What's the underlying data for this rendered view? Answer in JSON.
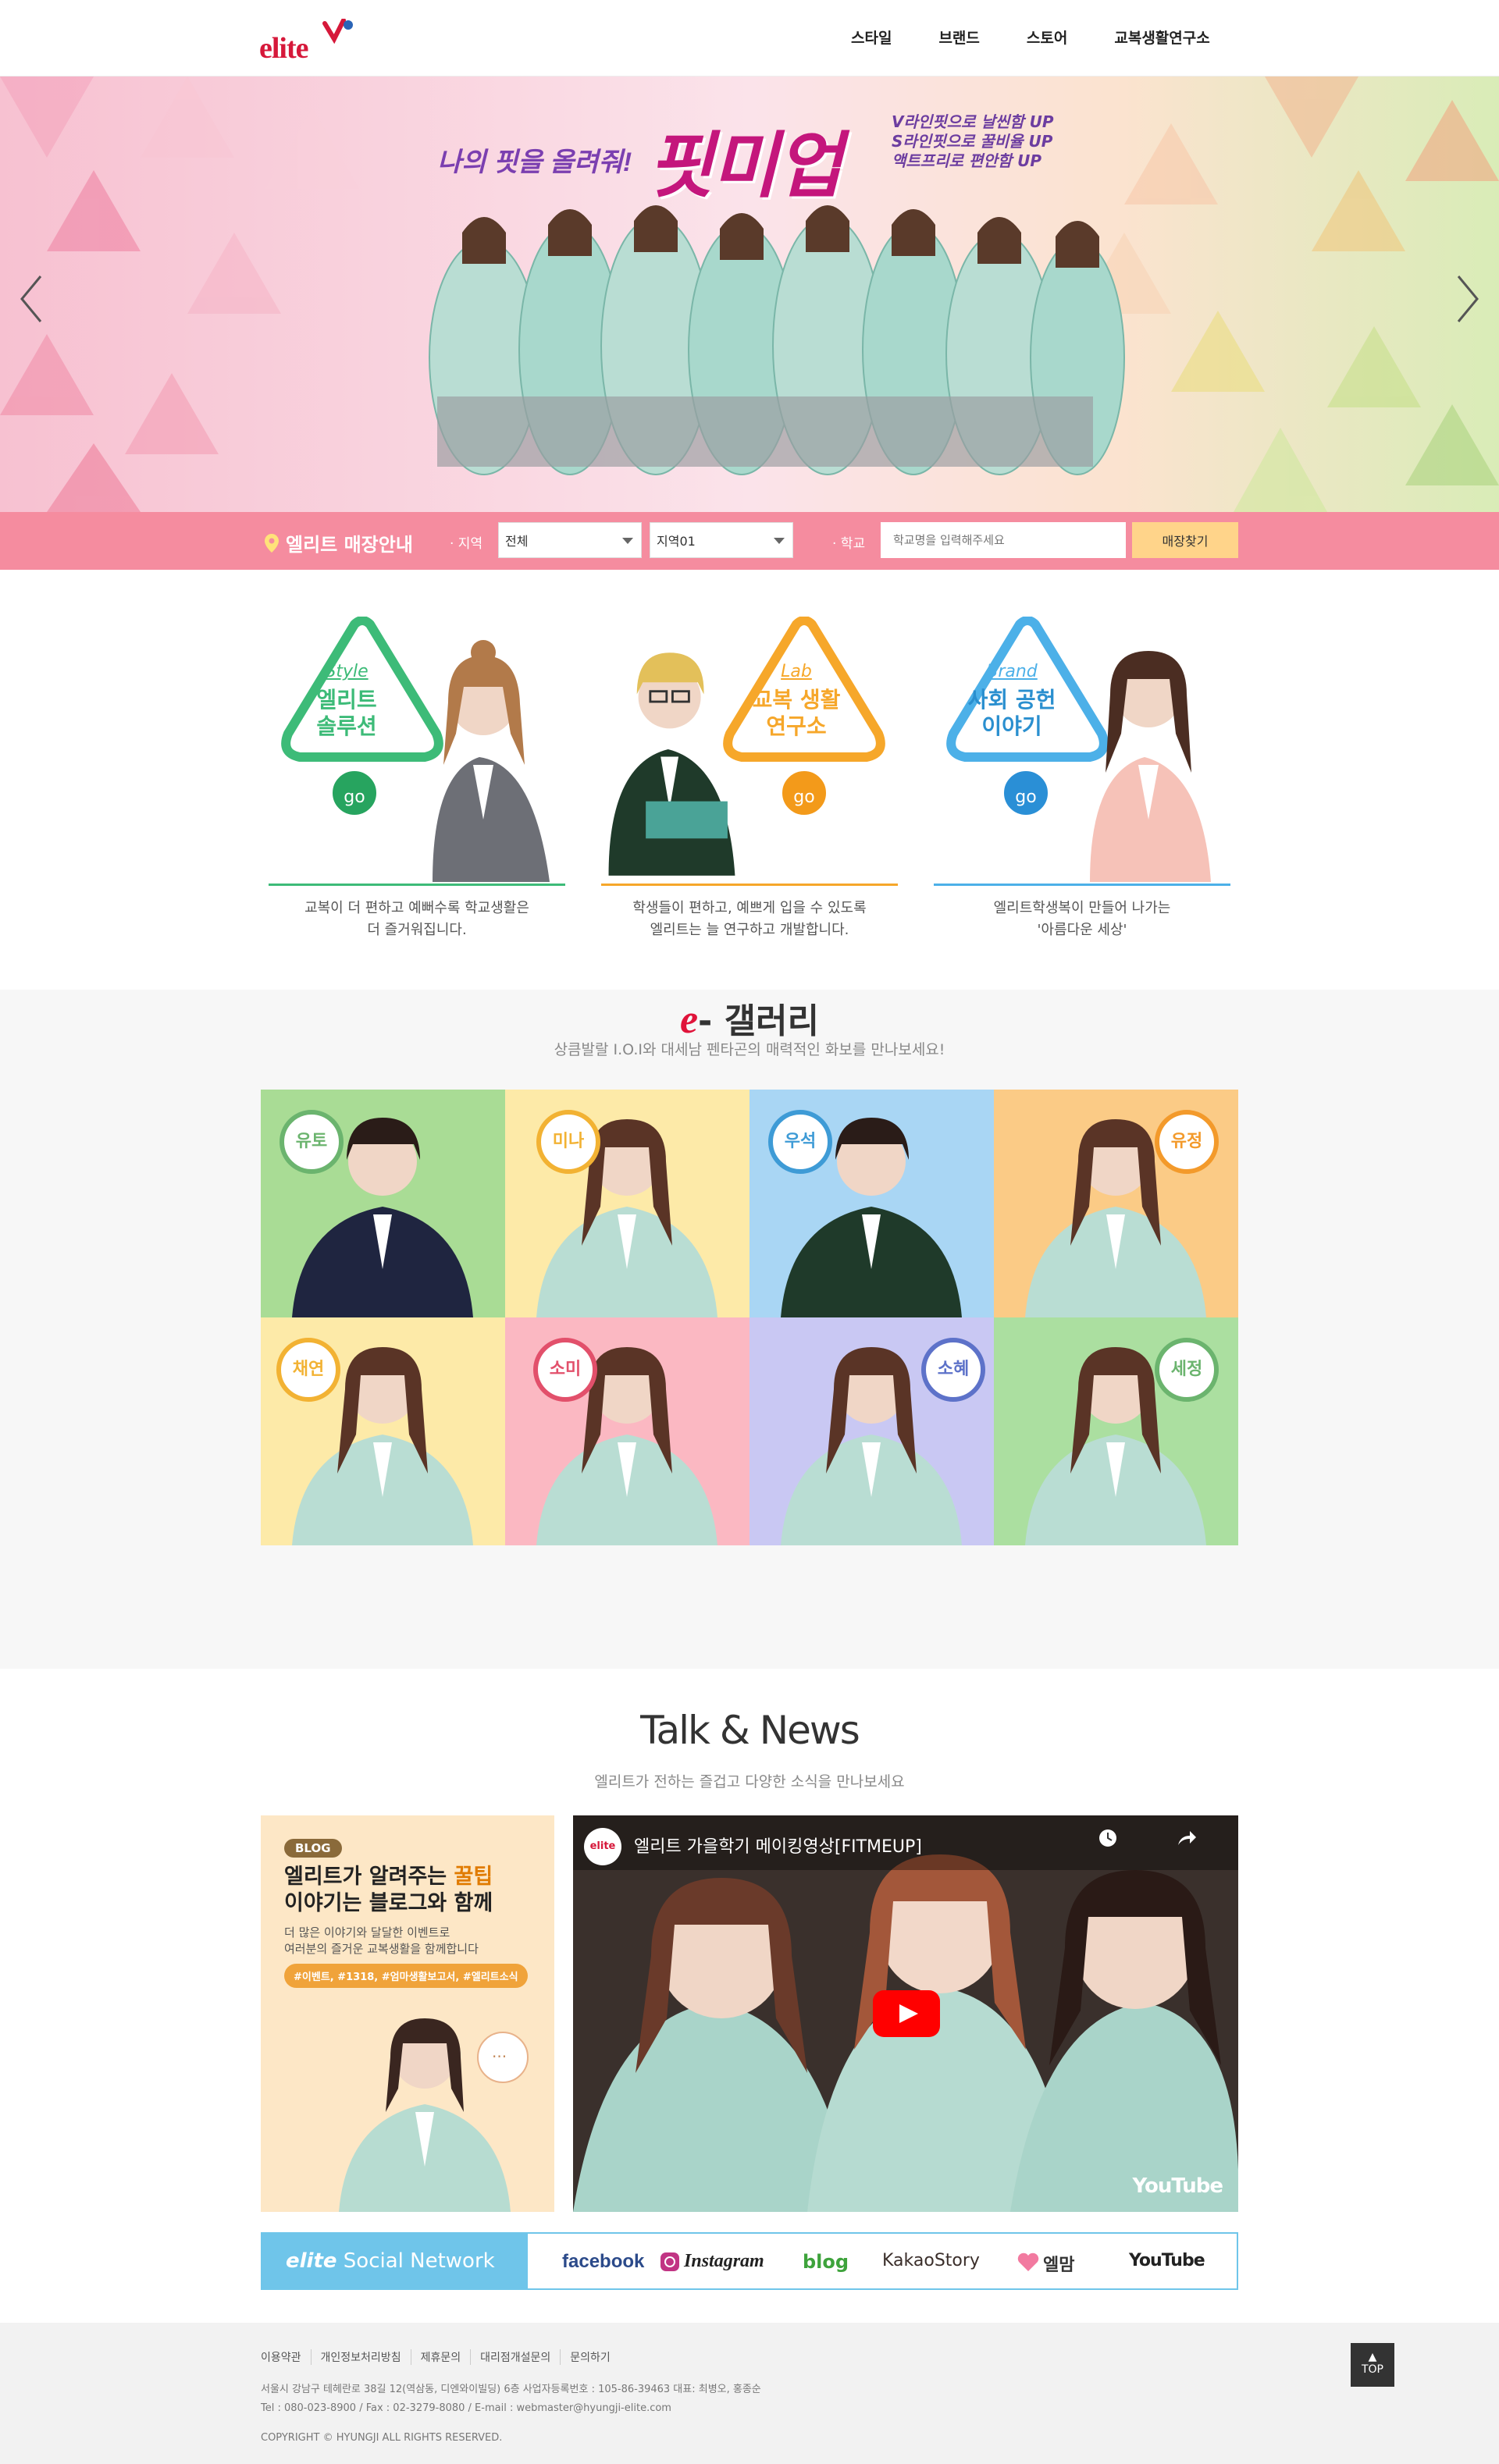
{
  "header": {
    "logo_text": "elite",
    "nav": [
      "스타일",
      "브랜드",
      "스토어",
      "교복생활연구소"
    ]
  },
  "hero": {
    "subtitle": "나의 핏을 올려줘!",
    "title": "핏미업",
    "side_lines": [
      "V라인핏으로 날씬함 UP",
      "S라인핏으로 꿀비율 UP",
      "액트프리로 편안함 UP"
    ]
  },
  "finder": {
    "title": "엘리트 매장안내",
    "region_label": "· 지역",
    "region_value": "전체",
    "area_value": "지역01",
    "school_label": "· 학교",
    "school_placeholder": "학교명을 입력해주세요",
    "button": "매장찾기"
  },
  "cards": [
    {
      "en": "Style",
      "ko1": "엘리트",
      "ko2": "솔루션",
      "go": "go",
      "desc1": "교복이 더 편하고 예뻐수록 학교생활은",
      "desc2": "더 즐거워집니다.",
      "color": "#3dbb78"
    },
    {
      "en": "Lab",
      "ko1": "교복 생활",
      "ko2": "연구소",
      "go": "go",
      "desc1": "학생들이 편하고, 예쁘게 입을 수 있도록",
      "desc2": "엘리트는 늘 연구하고 개발합니다.",
      "color": "#f6a72a"
    },
    {
      "en": "Brand",
      "ko1": "사회 공헌",
      "ko2": "이야기",
      "go": "go",
      "desc1": "엘리트학생복이 만들어 나가는",
      "desc2": "'아름다운 세상'",
      "color": "#4cb0e8"
    }
  ],
  "gallery": {
    "title_e": "e",
    "title": "- 갤러리",
    "subtitle": "상큼발랄 I.O.I와 대세남 펜타곤의 매력적인 화보를 만나보세요!",
    "tiles": [
      {
        "name": "유토",
        "bg": "#a9dc95",
        "ring": "#6bb46e"
      },
      {
        "name": "미나",
        "bg": "#fdeaa8",
        "ring": "#f2b233"
      },
      {
        "name": "우석",
        "bg": "#a9d6f4",
        "ring": "#3e9bd6"
      },
      {
        "name": "유정",
        "bg": "#fbcb86",
        "ring": "#f39a2b"
      },
      {
        "name": "채연",
        "bg": "#fdeaa8",
        "ring": "#f2b233"
      },
      {
        "name": "소미",
        "bg": "#fbb8c2",
        "ring": "#e2506b"
      },
      {
        "name": "소혜",
        "bg": "#c9c8f3",
        "ring": "#5d72c9"
      },
      {
        "name": "세정",
        "bg": "#abdfa0",
        "ring": "#6bb46e"
      }
    ]
  },
  "talk": {
    "title": "Talk & News",
    "subtitle": "엘리트가 전하는 즐겁고 다양한 소식을 만나보세요",
    "blog_tag": "BLOG",
    "blog_h1a": "엘리트가 알려주는 ",
    "blog_h1b": "꿀팁",
    "blog_h2": "이야기는 블로그와 함께",
    "blog_p1": "더 많은 이야기와 달달한 이벤트로",
    "blog_p2": "여러분의 즐거운 교복생활을 함께합니다",
    "blog_tags": "#이벤트, #1318, #엄마생활보고서, #엘리트소식",
    "video_channel": "elite",
    "video_title": "엘리트 가을학기 메이킹영상[FITMEUP]",
    "video_brand": "YouTube"
  },
  "social": {
    "label_logo": "elite",
    "label_text": " Social Network",
    "items": [
      "facebook",
      "Instagram",
      "blog",
      "KakaoStory",
      "엘맘",
      "YouTube"
    ]
  },
  "footer": {
    "links": [
      "이용약관",
      "개인정보처리방침",
      "제휴문의",
      "대리점개설문의",
      "문의하기"
    ],
    "address": "서울시 강남구 테헤란로 38길 12(역삼동, 디엔와이빌딩) 6층 사업자등록번호 : 105-86-39463 대표: 최병오, 홍종순",
    "contact": "Tel : 080-023-8900 / Fax : 02-3279-8080 / E-mail : webmaster@hyungji-elite.com",
    "copyright": "COPYRIGHT © HYUNGJI ALL RIGHTS RESERVED.",
    "top": "TOP"
  }
}
